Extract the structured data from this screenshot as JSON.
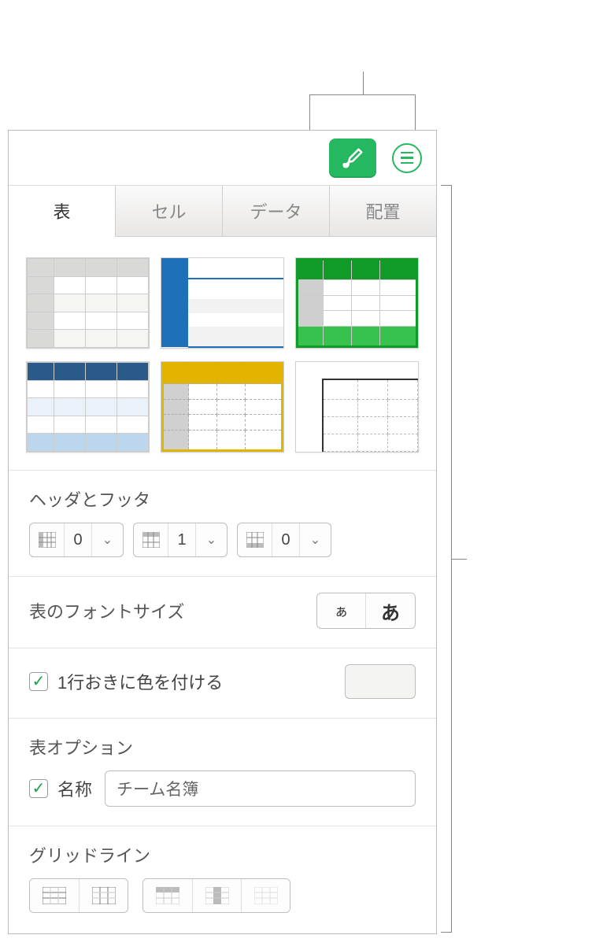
{
  "tabs": {
    "table": "表",
    "cell": "セル",
    "data": "データ",
    "arrange": "配置"
  },
  "sections": {
    "header_footer": "ヘッダとフッタ",
    "font_size": "表のフォントサイズ",
    "alternating": "1行おきに色を付ける",
    "options": "表オプション",
    "name_label": "名称",
    "gridlines": "グリッドライン"
  },
  "values": {
    "header_cols": "0",
    "header_rows": "1",
    "footer_rows": "0",
    "font_small": "ぁ",
    "font_large": "あ",
    "table_name": "チーム名簿"
  }
}
